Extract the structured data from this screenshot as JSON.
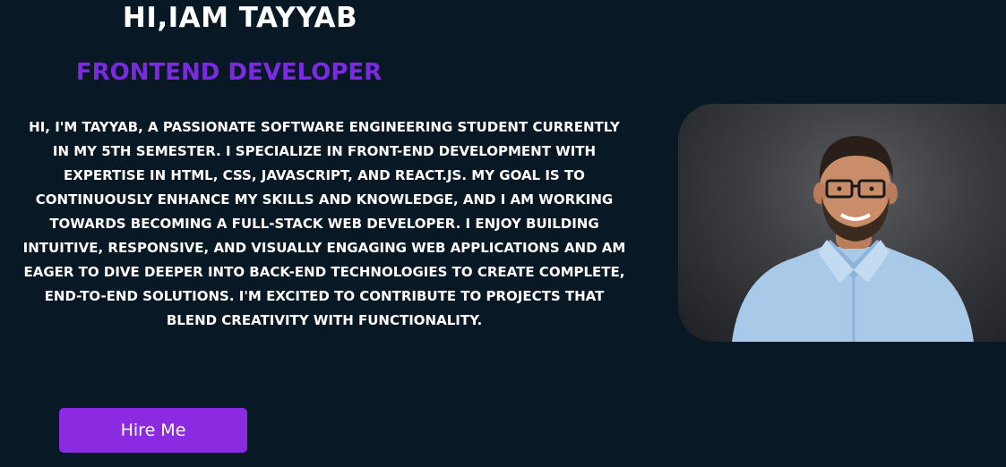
{
  "hero": {
    "greeting": "HI,IAM TAYYAB",
    "role": "FRONTEND DEVELOPER",
    "bio": "HI, I'M TAYYAB, A PASSIONATE SOFTWARE ENGINEERING STUDENT CURRENTLY IN MY 5TH SEMESTER. I SPECIALIZE IN FRONT-END DEVELOPMENT WITH EXPERTISE IN HTML, CSS, JAVASCRIPT, AND REACT.JS. MY GOAL IS TO CONTINUOUSLY ENHANCE MY SKILLS AND KNOWLEDGE, AND I AM WORKING TOWARDS BECOMING A FULL-STACK WEB DEVELOPER. I ENJOY BUILDING INTUITIVE, RESPONSIVE, AND VISUALLY ENGAGING WEB APPLICATIONS AND AM EAGER TO DIVE DEEPER INTO BACK-END TECHNOLOGIES TO CREATE COMPLETE, END-TO-END SOLUTIONS. I'M EXCITED TO CONTRIBUTE TO PROJECTS THAT BLEND CREATIVITY WITH FUNCTIONALITY.",
    "hire_button_label": "Hire Me"
  },
  "colors": {
    "background": "#081925",
    "accent": "#8a2be2",
    "role_text": "#7a2be0",
    "text": "#ffffff"
  },
  "icons": {
    "profile_photo": "portrait-photo"
  }
}
